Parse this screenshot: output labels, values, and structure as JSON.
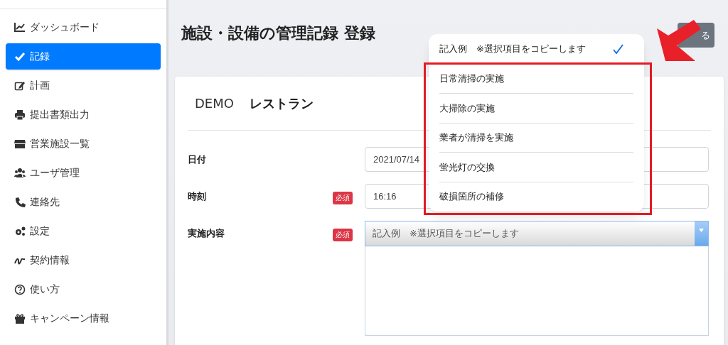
{
  "sidebar": {
    "items": [
      {
        "label": "ダッシュボード",
        "selected": false
      },
      {
        "label": "記録",
        "selected": true
      },
      {
        "label": "計画",
        "selected": false
      },
      {
        "label": "提出書類出力",
        "selected": false
      },
      {
        "label": "営業施設一覧",
        "selected": false
      },
      {
        "label": "ユーザ管理",
        "selected": false
      },
      {
        "label": "連絡先",
        "selected": false
      },
      {
        "label": "設定",
        "selected": false
      },
      {
        "label": "契約情報",
        "selected": false
      },
      {
        "label": "使い方",
        "selected": false
      },
      {
        "label": "キャンペーン情報",
        "selected": false
      }
    ]
  },
  "page": {
    "title": "施設・設備の管理記録 登録",
    "back_button": "る"
  },
  "card": {
    "company": "DEMO",
    "shop": "レストラン",
    "fields": [
      {
        "label": "日付",
        "kind": "input",
        "value": "2021/07/14"
      },
      {
        "label": "時刻",
        "badge": "必須",
        "kind": "input",
        "value": "16:16"
      },
      {
        "label": "実施内容",
        "badge": "必須",
        "kind": "select",
        "value": "記入例　※選択項目をコピーします"
      }
    ]
  },
  "picker": {
    "options": [
      {
        "label": "記入例　※選択項目をコピーします",
        "selected": true
      },
      {
        "label": "日常清掃の実施",
        "selected": false
      },
      {
        "label": "大掃除の実施",
        "selected": false
      },
      {
        "label": "業者が清掃を実施",
        "selected": false
      },
      {
        "label": "蛍光灯の交換",
        "selected": false
      },
      {
        "label": "破損箇所の補修",
        "selected": false
      }
    ]
  }
}
